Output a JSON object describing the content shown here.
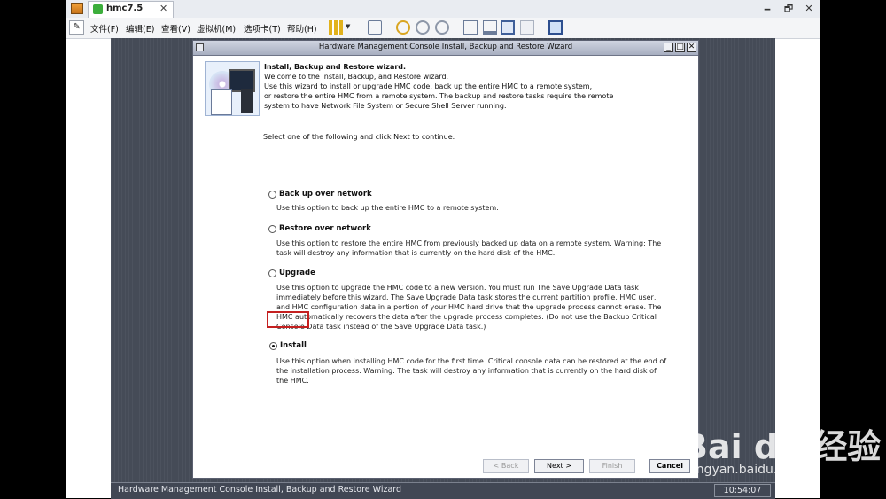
{
  "host": {
    "tab_title": "hmc7.5",
    "tab_close": "✕",
    "window_controls": [
      "🗕",
      "🗗",
      "✕"
    ],
    "menu": [
      "文件(F)",
      "编辑(E)",
      "查看(V)",
      "虚拟机(M)",
      "选项卡(T)",
      "帮助(H)"
    ]
  },
  "wizard": {
    "title": "Hardware Management Console Install, Backup and Restore Wizard",
    "heading": "Install, Backup and Restore wizard.",
    "intro": [
      "Welcome to the Install, Backup, and Restore wizard.",
      "Use this wizard to install or upgrade HMC code, back up the entire HMC to a remote system,",
      "or restore the entire HMC from a remote system. The backup and restore tasks require the remote",
      "system to have Network File System or Secure Shell Server running."
    ],
    "prompt": "Select one of the following and click Next to continue.",
    "options": [
      {
        "label": "Back up over network",
        "selected": false,
        "desc": [
          "Use this option to back up the entire HMC to a remote system."
        ]
      },
      {
        "label": "Restore over network",
        "selected": false,
        "desc": [
          "Use this option to restore the entire HMC from previously backed up data on a remote system.  Warning: The",
          "task will destroy any information that is currently on the hard disk of the HMC."
        ]
      },
      {
        "label": "Upgrade",
        "selected": false,
        "desc": [
          "Use this option to upgrade the HMC code to a new version. You must run The Save Upgrade Data task",
          "immediately before this wizard. The Save Upgrade Data task stores the current partition profile, HMC user,",
          "and HMC configuration data in a portion of your HMC hard drive that the upgrade process cannot erase. The",
          "HMC automatically recovers the data after the upgrade process completes. (Do not use the Backup Critical",
          "Console Data task instead of the Save Upgrade Data task.)"
        ]
      },
      {
        "label": "Install",
        "selected": true,
        "desc": [
          "Use this option when installing HMC code for the first time. Critical console data can be restored at the end of",
          "the installation process. Warning:  The task will destroy any information that is currently on the hard disk of",
          "the HMC."
        ]
      }
    ],
    "buttons": {
      "back": "< Back",
      "next": "Next >",
      "finish": "Finish",
      "cancel": "Cancel"
    }
  },
  "statusbar": {
    "title": "Hardware Management Console Install, Backup and Restore Wizard",
    "clock": "10:54:07"
  },
  "watermark": {
    "text": "Bai du 经验",
    "url": "jingyan.baidu.com"
  }
}
